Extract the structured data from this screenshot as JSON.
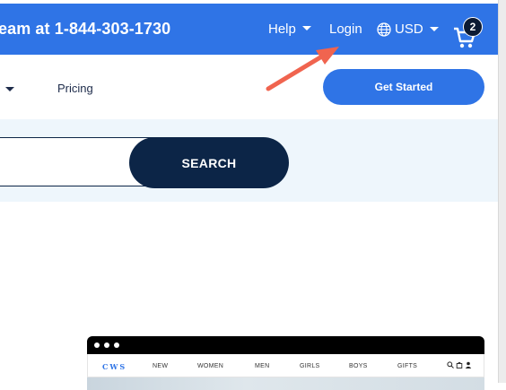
{
  "topbar": {
    "promo_text": "eam at 1-844-303-1730",
    "help_label": "Help",
    "login_label": "Login",
    "currency_label": "USD",
    "cart_count": "2",
    "bg_color": "#2f74e6"
  },
  "subnav": {
    "pricing_label": "Pricing",
    "get_started_label": "Get Started"
  },
  "search": {
    "placeholder": "",
    "button_label": "SEARCH"
  },
  "annotation": {
    "arrow_color": "#f0644f"
  },
  "preview": {
    "logo": "CWS",
    "nav_items": [
      "NEW",
      "WOMEN",
      "MEN",
      "GIRLS",
      "BOYS",
      "GIFTS"
    ],
    "icons": [
      "search-icon",
      "bag-icon",
      "user-icon"
    ]
  }
}
